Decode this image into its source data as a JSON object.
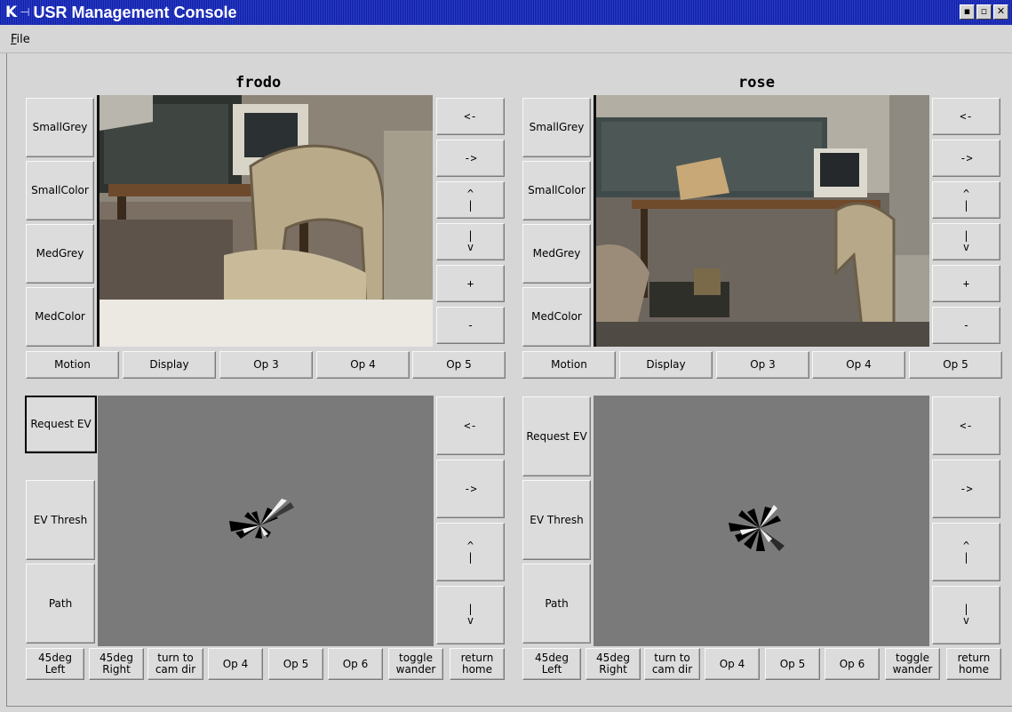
{
  "window": {
    "logo": "K",
    "pin": "⊣",
    "title": "USR Management Console",
    "controls": [
      "▪",
      "▫",
      "✕"
    ]
  },
  "menu": {
    "file_label": "File",
    "file_mnemonic": "F",
    "file_rest": "ile"
  },
  "panels": [
    {
      "name": "frodo",
      "camera_buttons": [
        "SmallGrey",
        "SmallColor",
        "MedGrey",
        "MedColor"
      ],
      "camera_nav": [
        "<-",
        "->",
        "^\n|",
        "|\nv",
        "+",
        "-"
      ],
      "camera_ops": [
        "Motion",
        "Display",
        "Op 3",
        "Op 4",
        "Op 5"
      ],
      "map_buttons": [
        "Request EV",
        "EV Thresh",
        "Path"
      ],
      "map_nav": [
        "<-",
        "->",
        "^\n|",
        "|\nv"
      ],
      "map_ops": [
        "45deg\nLeft",
        "45deg\nRight",
        "turn to\ncam dir",
        "Op 4",
        "Op 5",
        "Op 6",
        "toggle\nwander",
        "return\nhome"
      ]
    },
    {
      "name": "rose",
      "camera_buttons": [
        "SmallGrey",
        "SmallColor",
        "MedGrey",
        "MedColor"
      ],
      "camera_nav": [
        "<-",
        "->",
        "^\n|",
        "|\nv",
        "+",
        "-"
      ],
      "camera_ops": [
        "Motion",
        "Display",
        "Op 3",
        "Op 4",
        "Op 5"
      ],
      "map_buttons": [
        "Request EV",
        "EV Thresh",
        "Path"
      ],
      "map_nav": [
        "<-",
        "->",
        "^\n|",
        "|\nv"
      ],
      "map_ops": [
        "45deg\nLeft",
        "45deg\nRight",
        "turn to\ncam dir",
        "Op 4",
        "Op 5",
        "Op 6",
        "toggle\nwander",
        "return\nhome"
      ]
    }
  ],
  "colors": {
    "titlebar": "#1d2fb8",
    "background": "#d6d6d6",
    "map_background": "#7a7a7a"
  }
}
